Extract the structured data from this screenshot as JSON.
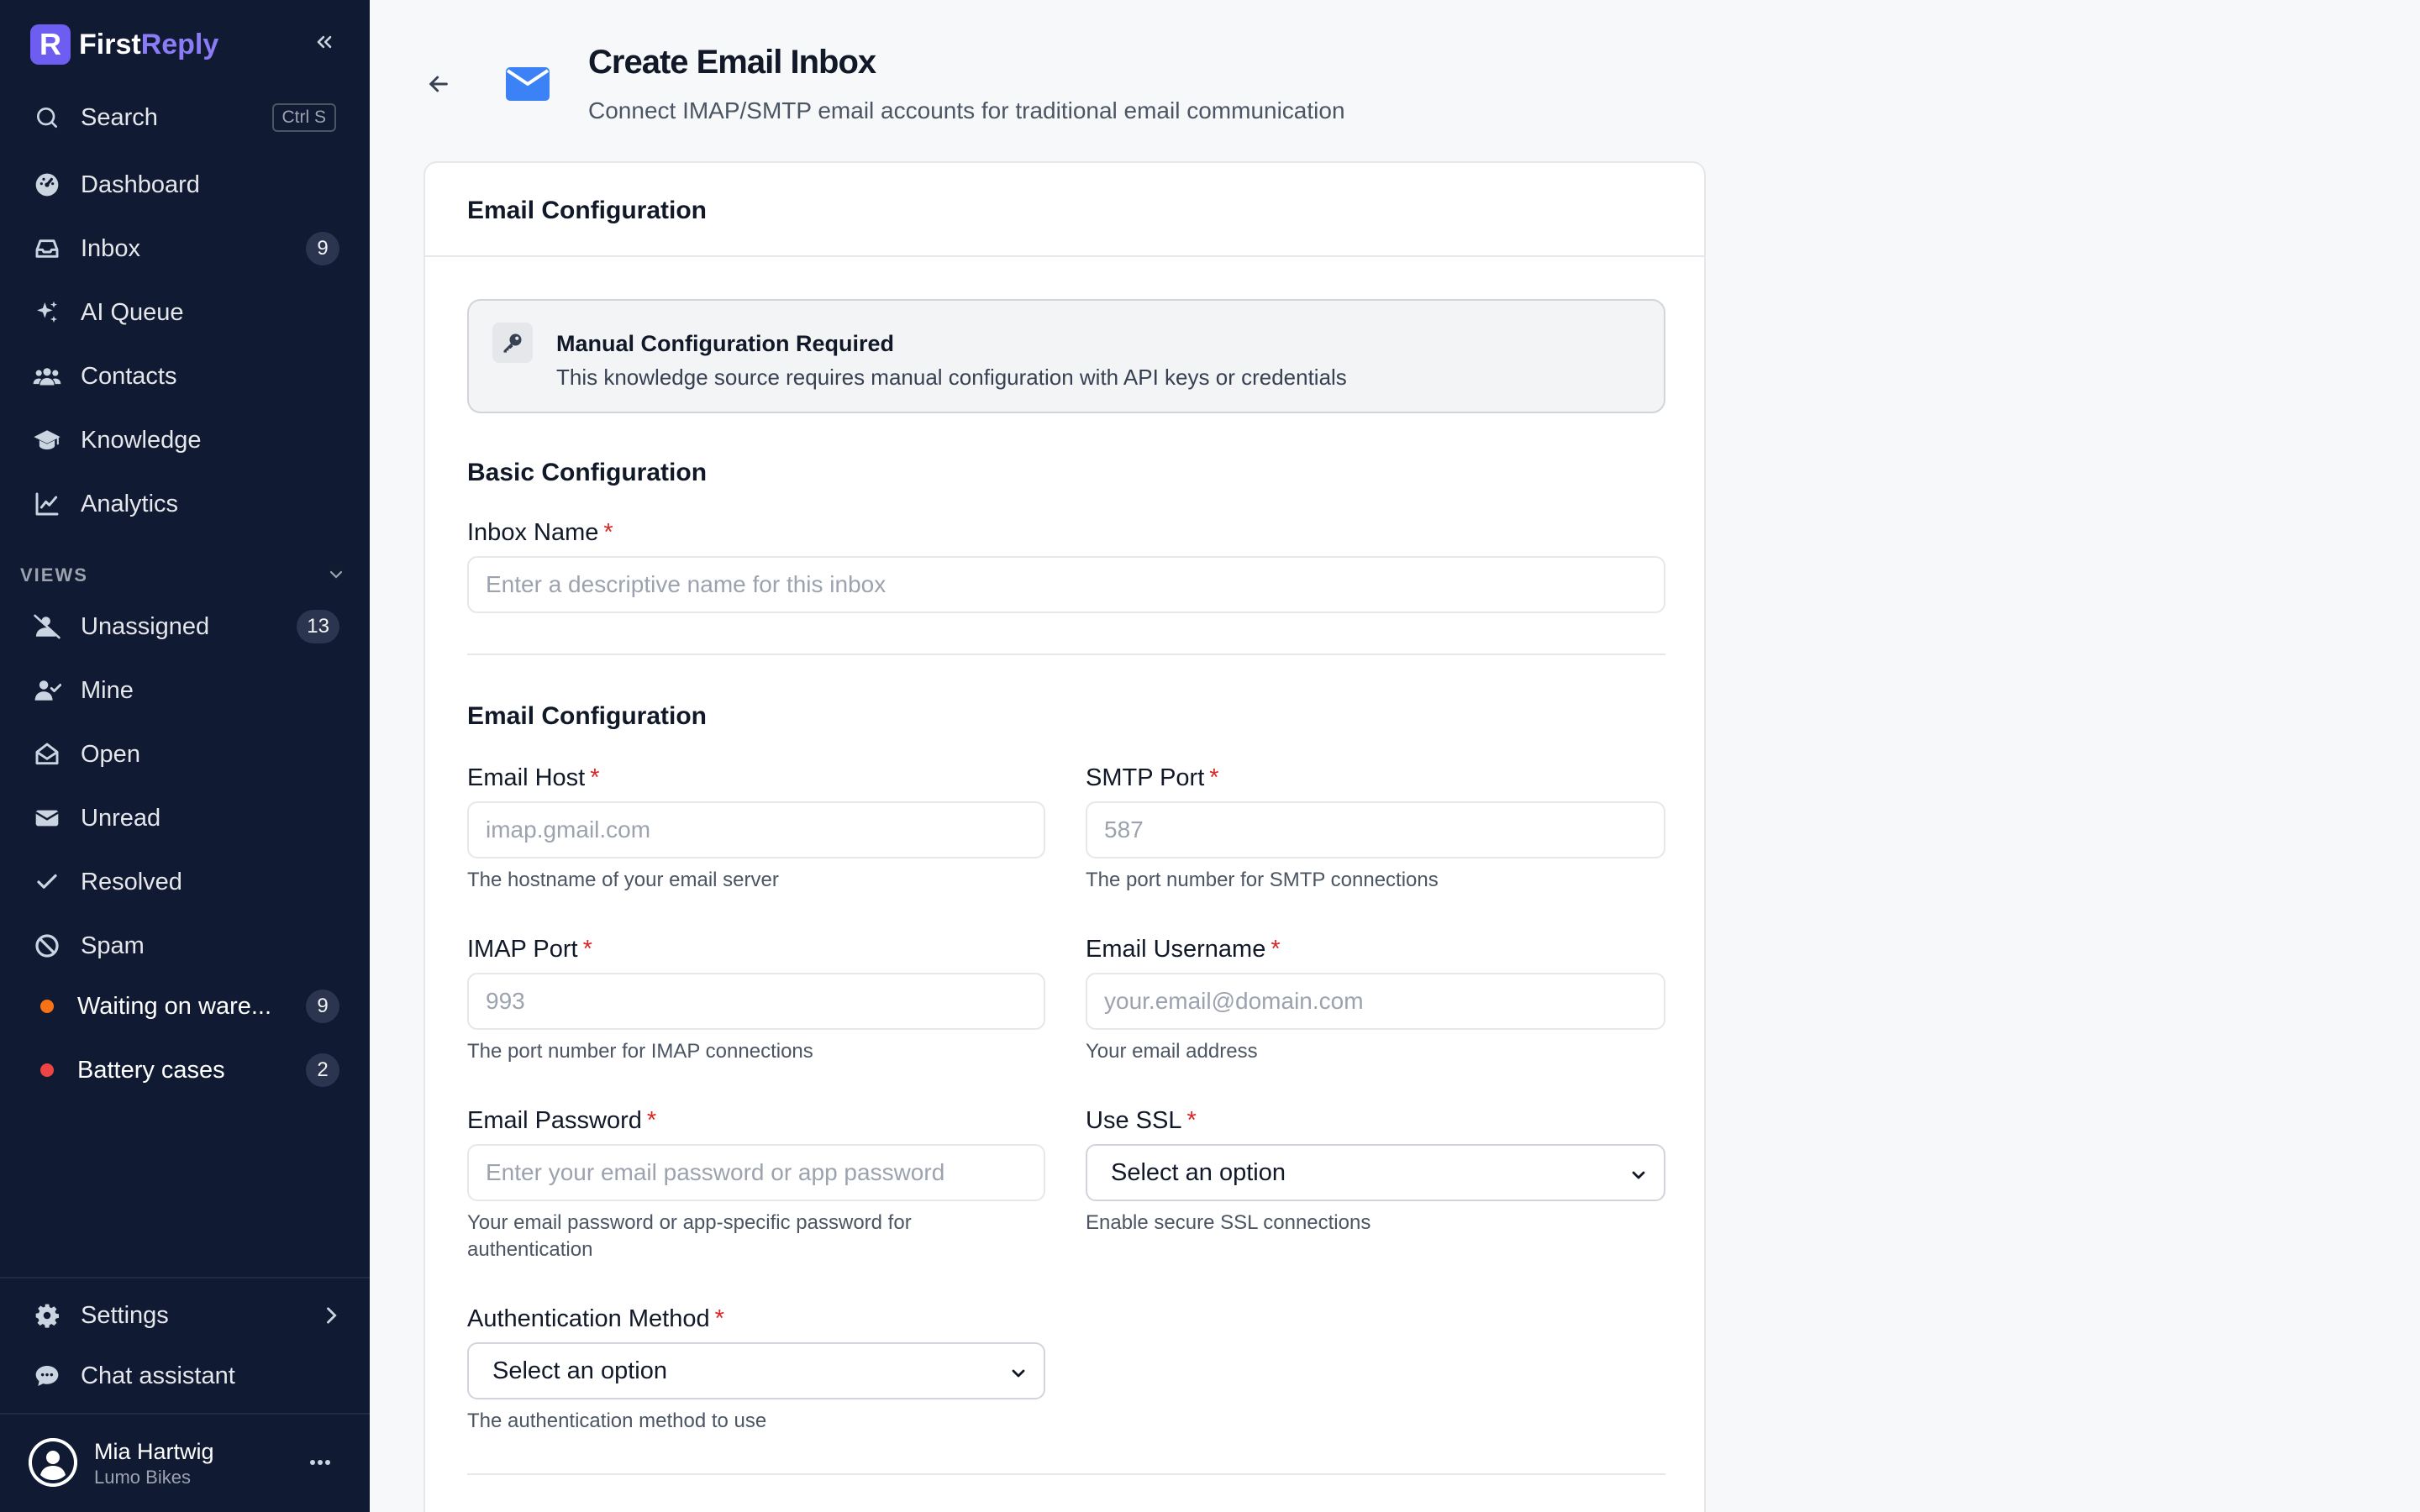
{
  "brand": {
    "logo_letter": "R",
    "name_part1": "First",
    "name_part2": "Reply",
    "accent": "#8b7cf6"
  },
  "sidebar": {
    "search": {
      "label": "Search",
      "shortcut": "Ctrl S"
    },
    "nav": [
      {
        "label": "Dashboard",
        "icon": "dashboard-icon"
      },
      {
        "label": "Inbox",
        "icon": "inbox-icon",
        "badge": "9"
      },
      {
        "label": "AI Queue",
        "icon": "sparkles-icon"
      },
      {
        "label": "Contacts",
        "icon": "users-icon"
      },
      {
        "label": "Knowledge",
        "icon": "graduation-cap-icon"
      },
      {
        "label": "Analytics",
        "icon": "chart-line-icon"
      }
    ],
    "views_label": "VIEWS",
    "views": [
      {
        "label": "Unassigned",
        "icon": "user-slash-icon",
        "badge": "13"
      },
      {
        "label": "Mine",
        "icon": "user-check-icon"
      },
      {
        "label": "Open",
        "icon": "envelope-open-icon"
      },
      {
        "label": "Unread",
        "icon": "envelope-icon"
      },
      {
        "label": "Resolved",
        "icon": "check-icon"
      },
      {
        "label": "Spam",
        "icon": "ban-icon"
      },
      {
        "label": "Waiting on ware...",
        "dot_color": "#f97316",
        "badge": "9"
      },
      {
        "label": "Battery cases",
        "dot_color": "#ef4444",
        "badge": "2"
      }
    ],
    "settings_label": "Settings",
    "chat_label": "Chat assistant",
    "user": {
      "name": "Mia Hartwig",
      "org": "Lumo Bikes"
    }
  },
  "page": {
    "title": "Create Email Inbox",
    "subtitle": "Connect IMAP/SMTP email accounts for traditional email communication"
  },
  "card": {
    "title": "Email Configuration",
    "alert": {
      "title": "Manual Configuration Required",
      "description": "This knowledge source requires manual configuration with API keys or credentials"
    },
    "basic": {
      "title": "Basic Configuration",
      "inbox_name": {
        "label": "Inbox Name",
        "required": "*",
        "placeholder": "Enter a descriptive name for this inbox"
      }
    },
    "email": {
      "title": "Email Configuration",
      "email_host": {
        "label": "Email Host",
        "required": "*",
        "placeholder": "imap.gmail.com",
        "help": "The hostname of your email server"
      },
      "smtp_port": {
        "label": "SMTP Port",
        "required": "*",
        "placeholder": "587",
        "help": "The port number for SMTP connections"
      },
      "imap_port": {
        "label": "IMAP Port",
        "required": "*",
        "placeholder": "993",
        "help": "The port number for IMAP connections"
      },
      "email_username": {
        "label": "Email Username",
        "required": "*",
        "placeholder": "your.email@domain.com",
        "help": "Your email address"
      },
      "email_password": {
        "label": "Email Password",
        "required": "*",
        "placeholder": "Enter your email password or app password",
        "help": "Your email password or app-specific password for authentication"
      },
      "use_ssl": {
        "label": "Use SSL",
        "required": "*",
        "value": "Select an option",
        "help": "Enable secure SSL connections"
      },
      "auth_method": {
        "label": "Authentication Method",
        "required": "*",
        "value": "Select an option",
        "help": "The authentication method to use"
      }
    }
  }
}
